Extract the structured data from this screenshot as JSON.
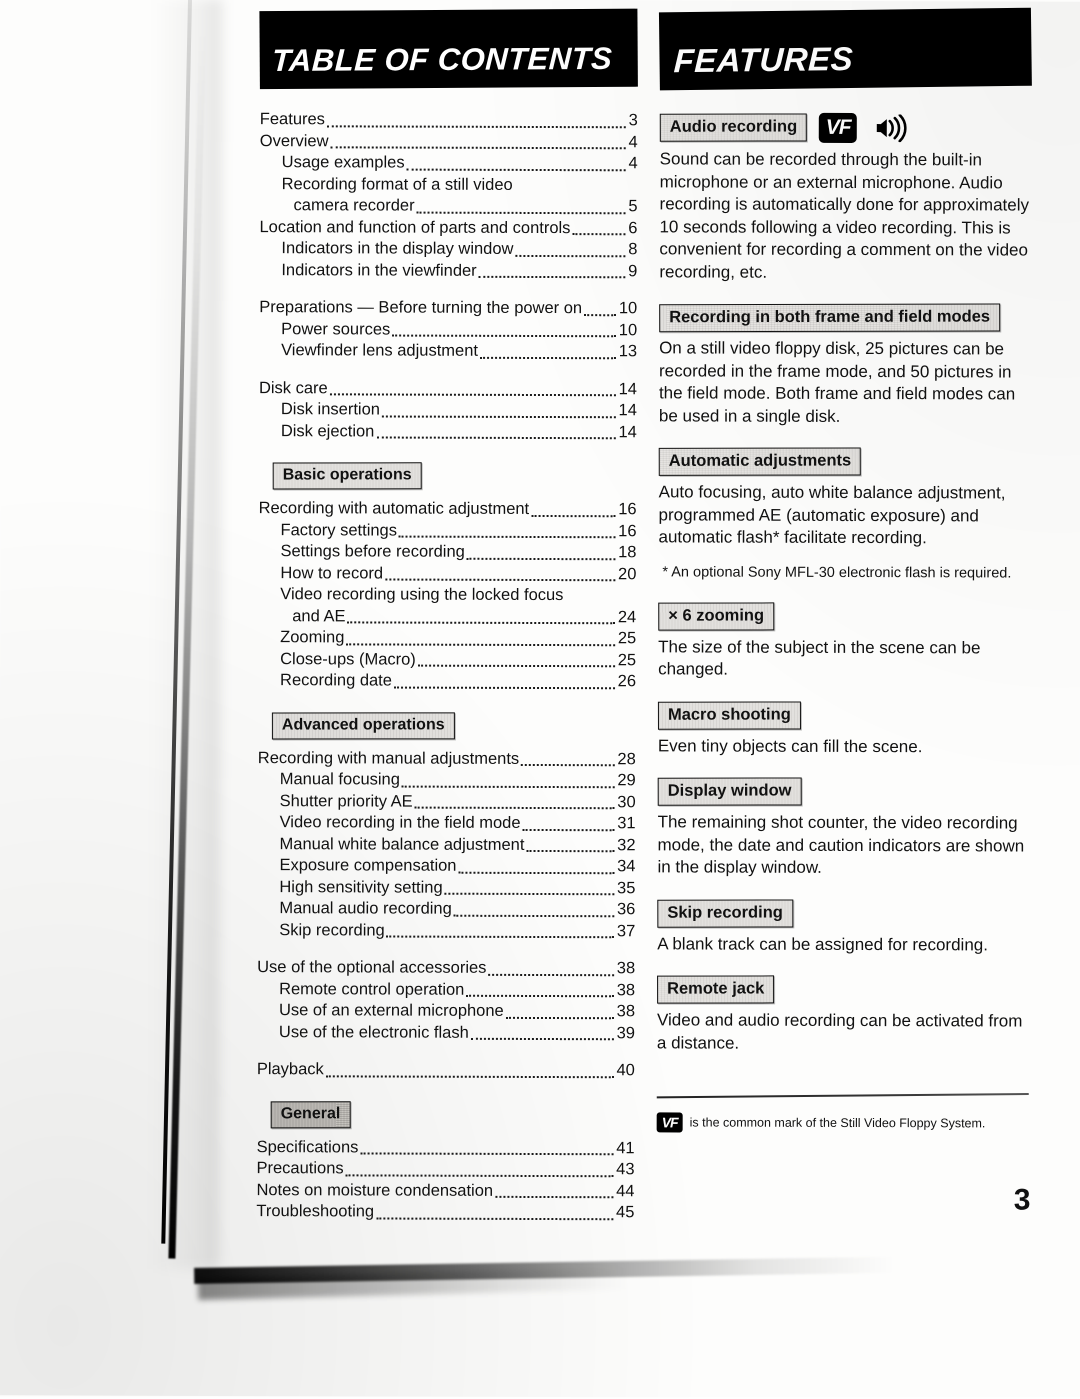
{
  "page": {
    "number": "3",
    "paper_tone": "#fdfdfc",
    "ink": "#111111"
  },
  "left_column": {
    "banner_title": "TABLE OF CONTENTS",
    "groups": [
      {
        "label": null,
        "entries": [
          {
            "title": "Features",
            "page": "3",
            "level": 1
          },
          {
            "title": "Overview",
            "page": "4",
            "level": 1
          },
          {
            "title": "Usage examples",
            "page": "4",
            "level": 2
          },
          {
            "title": "Recording format of a still video",
            "page": "",
            "level": 2,
            "dots": false
          },
          {
            "title": "camera recorder",
            "page": "5",
            "level": 3
          },
          {
            "title": "Location and function of parts and controls",
            "page": "6",
            "level": 1
          },
          {
            "title": "Indicators in the display window",
            "page": "8",
            "level": 2
          },
          {
            "title": "Indicators in the viewfinder",
            "page": "9",
            "level": 2
          }
        ]
      },
      {
        "label": null,
        "entries": [
          {
            "title": "Preparations — Before turning the power on",
            "page": "10",
            "level": 1
          },
          {
            "title": "Power sources",
            "page": "10",
            "level": 2
          },
          {
            "title": "Viewfinder lens adjustment",
            "page": "13",
            "level": 2
          }
        ]
      },
      {
        "label": null,
        "entries": [
          {
            "title": "Disk care",
            "page": "14",
            "level": 1
          },
          {
            "title": "Disk insertion",
            "page": "14",
            "level": 2
          },
          {
            "title": "Disk ejection",
            "page": "14",
            "level": 2
          }
        ]
      },
      {
        "label": "Basic operations",
        "entries": [
          {
            "title": "Recording with automatic adjustment",
            "page": "16",
            "level": 1
          },
          {
            "title": "Factory settings",
            "page": "16",
            "level": 2
          },
          {
            "title": "Settings before recording",
            "page": "18",
            "level": 2
          },
          {
            "title": "How to record",
            "page": "20",
            "level": 2
          },
          {
            "title": "Video recording using the locked focus",
            "page": "",
            "level": 2,
            "dots": false
          },
          {
            "title": "and AE",
            "page": "24",
            "level": 3
          },
          {
            "title": "Zooming",
            "page": "25",
            "level": 2
          },
          {
            "title": "Close-ups (Macro)",
            "page": "25",
            "level": 2
          },
          {
            "title": "Recording date",
            "page": "26",
            "level": 2
          }
        ]
      },
      {
        "label": "Advanced operations",
        "entries": [
          {
            "title": "Recording with manual adjustments",
            "page": "28",
            "level": 1
          },
          {
            "title": "Manual focusing",
            "page": "29",
            "level": 2
          },
          {
            "title": "Shutter priority AE",
            "page": "30",
            "level": 2
          },
          {
            "title": "Video recording in the field mode",
            "page": "31",
            "level": 2
          },
          {
            "title": "Manual white balance adjustment",
            "page": "32",
            "level": 2
          },
          {
            "title": "Exposure compensation",
            "page": "34",
            "level": 2
          },
          {
            "title": "High sensitivity setting",
            "page": "35",
            "level": 2
          },
          {
            "title": "Manual audio recording",
            "page": "36",
            "level": 2
          },
          {
            "title": "Skip recording",
            "page": "37",
            "level": 2
          }
        ]
      },
      {
        "label": null,
        "entries": [
          {
            "title": "Use of the optional accessories",
            "page": "38",
            "level": 1
          },
          {
            "title": "Remote control operation",
            "page": "38",
            "level": 2
          },
          {
            "title": "Use of an external microphone",
            "page": "38",
            "level": 2
          },
          {
            "title": "Use of the electronic flash",
            "page": "39",
            "level": 2
          }
        ]
      },
      {
        "label": null,
        "entries": [
          {
            "title": "Playback",
            "page": "40",
            "level": 1
          }
        ]
      },
      {
        "label": "General",
        "entries": [
          {
            "title": "Specifications",
            "page": "41",
            "level": 1
          },
          {
            "title": "Precautions",
            "page": "43",
            "level": 1
          },
          {
            "title": "Notes on moisture condensation",
            "page": "44",
            "level": 1
          },
          {
            "title": "Troubleshooting",
            "page": "45",
            "level": 1
          }
        ]
      }
    ]
  },
  "right_column": {
    "banner_title": "FEATURES",
    "blocks": [
      {
        "label": "Audio recording",
        "icons": [
          "vf-logo-icon",
          "sound-wave-icon"
        ],
        "body": "Sound can be recorded through the built-in microphone or an external microphone. Audio recording is automatically done for approximately 10 seconds following a video recording. This is convenient for recording a comment on the video recording, etc."
      },
      {
        "label": "Recording in both frame and field modes",
        "icons": [],
        "body": "On a still video floppy disk, 25 pictures can be recorded in the frame mode, and 50 pictures in the field mode. Both frame and field modes can be used in a single disk."
      },
      {
        "label": "Automatic adjustments",
        "icons": [],
        "body": "Auto focusing, auto white balance adjustment, programmed AE (automatic exposure) and automatic flash* facilitate recording.",
        "note": "* An optional Sony MFL-30 electronic flash is required."
      },
      {
        "label": "× 6 zooming",
        "icons": [],
        "body": "The size of the subject in the scene can be changed."
      },
      {
        "label": "Macro shooting",
        "icons": [],
        "body": "Even tiny objects can fill the scene."
      },
      {
        "label": "Display window",
        "icons": [],
        "body": "The remaining shot counter, the video recording mode, the date and caution indicators are shown in the display window."
      },
      {
        "label": "Skip recording",
        "icons": [],
        "body": "A blank track can be assigned for recording."
      },
      {
        "label": "Remote jack",
        "icons": [],
        "body": "Video and audio recording can be activated from a distance."
      }
    ]
  },
  "footer": {
    "vf_mark_label": "VF",
    "note": "is the common mark of the Still Video Floppy System."
  }
}
